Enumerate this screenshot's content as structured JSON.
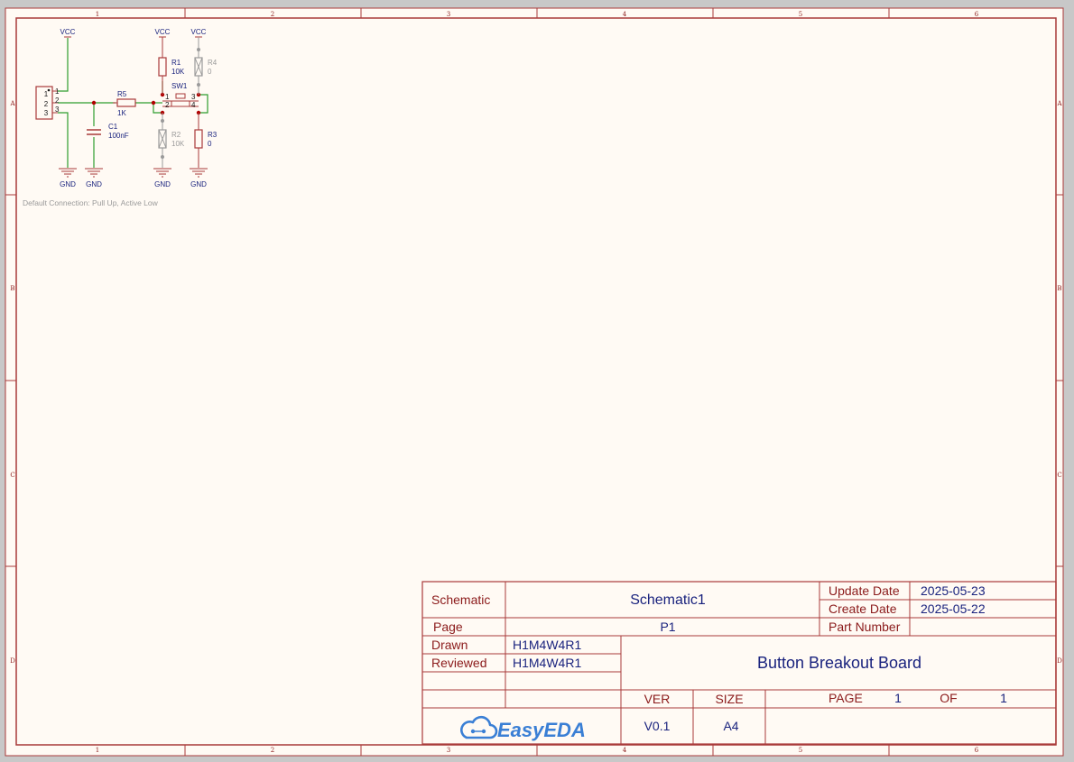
{
  "border": {
    "columns": [
      "1",
      "2",
      "3",
      "4",
      "5",
      "6"
    ],
    "rows": [
      "A",
      "B",
      "C",
      "D"
    ]
  },
  "schematic": {
    "power_labels": {
      "vcc": "VCC",
      "gnd": "GND"
    },
    "connector": {
      "pins": [
        "1",
        "2",
        "3"
      ]
    },
    "components": {
      "r5": {
        "ref": "R5",
        "value": "1K"
      },
      "c1": {
        "ref": "C1",
        "value": "100nF"
      },
      "r1": {
        "ref": "R1",
        "value": "10K"
      },
      "r2": {
        "ref": "R2",
        "value": "10K"
      },
      "r3": {
        "ref": "R3",
        "value": "0"
      },
      "r4": {
        "ref": "R4",
        "value": "0"
      },
      "sw1": {
        "ref": "SW1",
        "pins": [
          "1",
          "2",
          "3",
          "4"
        ]
      }
    },
    "note": "Default Connection: Pull Up, Active Low"
  },
  "title_block": {
    "schematic_label": "Schematic",
    "schematic_name": "Schematic1",
    "update_date_label": "Update Date",
    "update_date": "2025-05-23",
    "create_date_label": "Create Date",
    "create_date": "2025-05-22",
    "page_label": "Page",
    "page_value": "P1",
    "part_number_label": "Part Number",
    "part_number": "",
    "drawn_label": "Drawn",
    "drawn_value": "H1M4W4R1",
    "reviewed_label": "Reviewed",
    "reviewed_value": "H1M4W4R1",
    "board_title": "Button Breakout Board",
    "ver_label": "VER",
    "ver_value": "V0.1",
    "size_label": "SIZE",
    "size_value": "A4",
    "page_of_label": "PAGE",
    "page_num": "1",
    "of_label": "OF",
    "page_total": "1",
    "logo_text": "EasyEDA"
  },
  "colors": {
    "paper": "#fffaf4",
    "border": "#a93a3a",
    "wire": "#2e9e2e",
    "text_blue": "#1a237e",
    "logo_blue": "#3a7fd5",
    "grey": "#9a9a9a"
  }
}
